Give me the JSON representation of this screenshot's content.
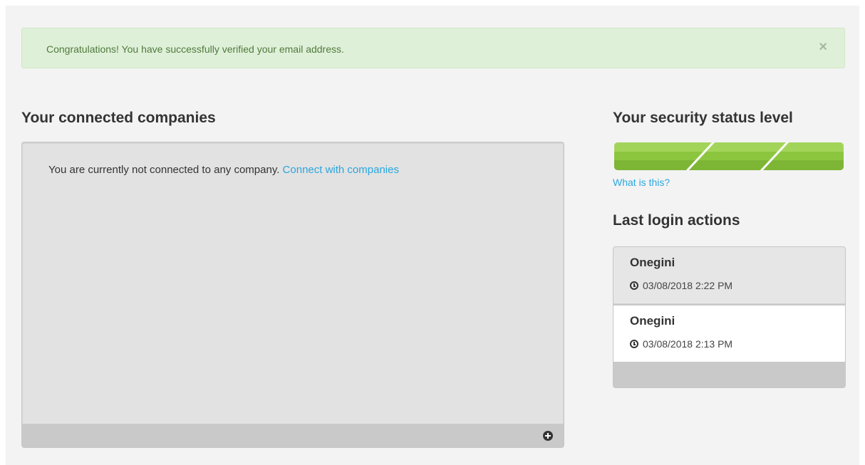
{
  "alert": {
    "message": "Congratulations! You have successfully verified your email address.",
    "close_label": "×",
    "color": "#dff0d8"
  },
  "companies": {
    "title": "Your connected companies",
    "empty_message": "You are currently not connected to any company.",
    "connect_link": "Connect with companies",
    "add_icon": "plus-circle-icon"
  },
  "security": {
    "title": "Your security status level",
    "level": "3 of 3",
    "bar_color": "#8cc63f",
    "info_link": "What is this?"
  },
  "last_login": {
    "title": "Last login actions",
    "items": [
      {
        "name": "Onegini",
        "time": "03/08/2018 2:22 PM"
      },
      {
        "name": "Onegini",
        "time": "03/08/2018 2:13 PM"
      }
    ],
    "time_icon": "clock-icon"
  },
  "colors": {
    "link": "#2ba6de",
    "panel_bg": "#e2e2e2",
    "footer_bg": "#c9c9c9"
  }
}
